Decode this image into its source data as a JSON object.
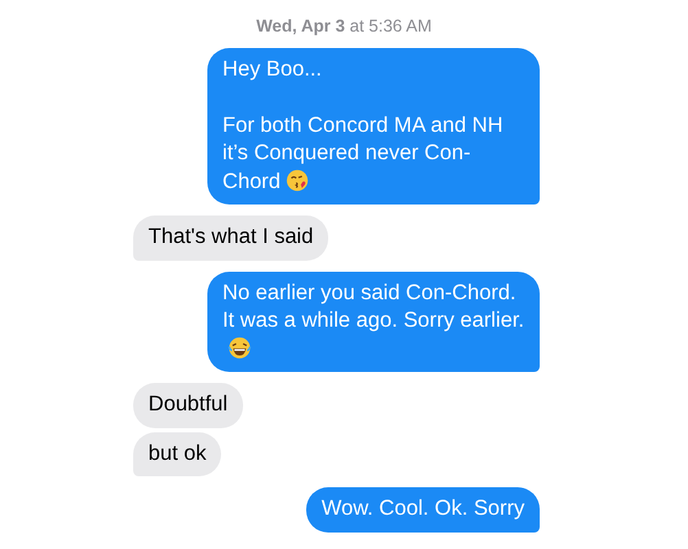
{
  "timestamp": "**Wed, Apr 3** at 5:36 AM",
  "messages": [
    {
      "kind": "sent",
      "paragraphs": [
        "Hey Boo...",
        "For both Concord MA and NH it’s Conquered never Con-Chord"
      ],
      "emoji": {
        "kind": "kiss"
      },
      "tail": true
    },
    {
      "kind": "received",
      "paragraphs": [
        "That's what I said"
      ],
      "tail": true
    },
    {
      "kind": "sent",
      "paragraphs": [
        "No earlier you said Con-Chord. It was a while ago. Sorry earlier."
      ],
      "emoji": {
        "kind": "laugh"
      },
      "tail": true
    },
    {
      "kind": "received",
      "paragraphs": [
        "Doubtful"
      ],
      "tail": false
    },
    {
      "kind": "received",
      "paragraphs": [
        "but ok"
      ],
      "tail": true
    },
    {
      "kind": "sent",
      "paragraphs": [
        "Wow. Cool. Ok. Sorry"
      ],
      "tail": true
    }
  ]
}
